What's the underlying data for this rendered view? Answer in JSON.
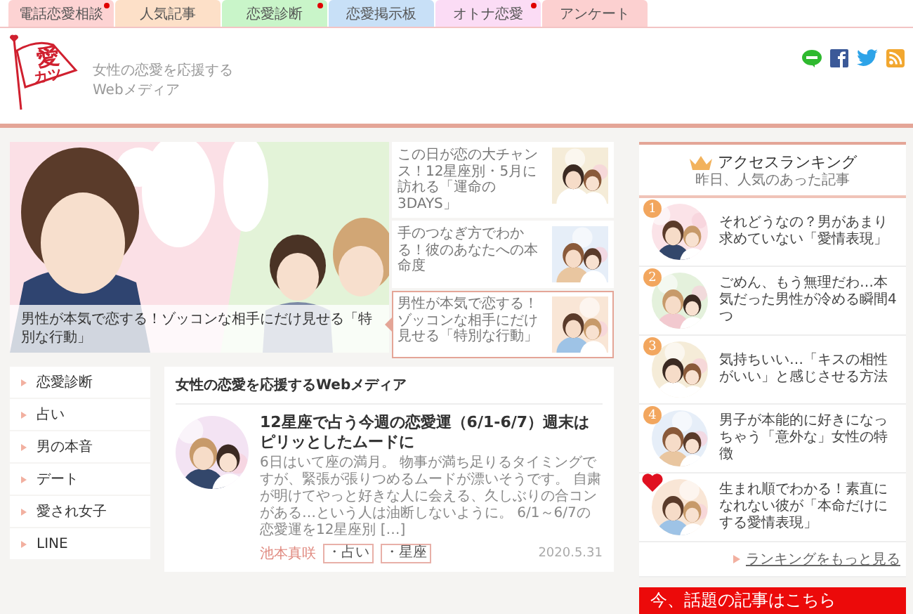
{
  "nav_tabs": [
    {
      "label": "電話恋愛相談",
      "color": "#fdd3d3",
      "marked": true
    },
    {
      "label": "人気記事",
      "color": "#fde0c8",
      "marked": false
    },
    {
      "label": "恋愛診断",
      "color": "#c9f5c9",
      "marked": true
    },
    {
      "label": "恋愛掲示板",
      "color": "#c8e0f7",
      "marked": false
    },
    {
      "label": "オトナ恋愛",
      "color": "#fbdcf5",
      "marked": true
    },
    {
      "label": "アンケート",
      "color": "#fcd0d0",
      "marked": false
    }
  ],
  "header": {
    "logo": {
      "main": "愛",
      "sub": "カツ"
    },
    "tagline": "女性の恋愛を応援するWebメディア"
  },
  "hero": {
    "main": {
      "caption": "男性が本気で恋する！ゾッコンな相手にだけ見せる「特別な行動」"
    },
    "side": [
      {
        "title": "この日が恋の大チャンス！12星座別・5月に訪れる「運命の3DAYS」",
        "selected": false
      },
      {
        "title": "手のつなぎ方でわかる！彼のあなたへの本命度",
        "selected": false
      },
      {
        "title": "男性が本気で恋する！ゾッコンな相手にだけ見せる「特別な行動」",
        "selected": true
      }
    ]
  },
  "ranking": {
    "title": "アクセスランキング",
    "subtitle": "昨日、人気のあった記事",
    "items": [
      {
        "kind": "number",
        "rank": "1",
        "title": "それどうなの？男があまり求めていない「愛情表現」"
      },
      {
        "kind": "number",
        "rank": "2",
        "title": "ごめん、もう無理だわ…本気だった男性が冷める瞬間4つ"
      },
      {
        "kind": "number",
        "rank": "3",
        "title": "気持ちいい…「キスの相性がいい」と感じさせる方法"
      },
      {
        "kind": "number",
        "rank": "4",
        "title": "男子が本能的に好きになっちゃう「意外な」女性の特徴"
      },
      {
        "kind": "heart",
        "title": "生まれ順でわかる！素直になれない彼が「本命だけにする愛情表現」"
      }
    ],
    "more_link": "ランキングをもっと見る",
    "banner": "今、話題の記事はこちら"
  },
  "category_menu": [
    "恋愛診断",
    "占い",
    "男の本音",
    "デート",
    "愛され女子",
    "LINE"
  ],
  "feed": {
    "heading": "女性の恋愛を応援するWebメディア",
    "articles": [
      {
        "title": "12星座で占う今週の恋愛運（6/1-6/7）週末はピリッとしたムードに",
        "excerpt": "6日はいて座の満月。 物事が満ち足りるタイミングですが、緊張が張りつめるムードが漂いそうです。 自粛が明けてやっと好きな人に会える、久しぶりの合コンがある…という人は油断しないように。 6/1～6/7の恋愛運を12星座別 […]",
        "author": "池本真咲",
        "tags": [
          "・占い",
          "・星座"
        ],
        "date": "2020.5.31"
      }
    ]
  }
}
